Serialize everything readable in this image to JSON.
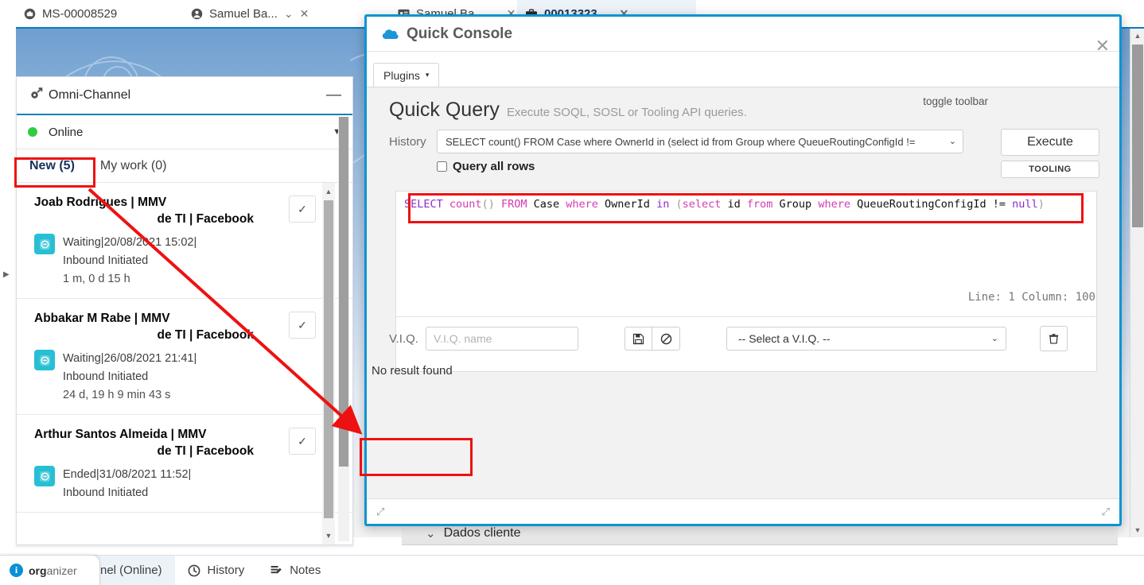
{
  "console_tabs": [
    {
      "label": "MS-00008529",
      "icon": "case-icon",
      "active": false
    },
    {
      "label": "Samuel Ba...",
      "icon": "person-icon",
      "active": false
    },
    {
      "label": "Samuel Ba...",
      "icon": "contact-card-icon",
      "active": false
    },
    {
      "label": "00013323",
      "icon": "briefcase-icon",
      "active": true
    }
  ],
  "omni": {
    "title": "Omni-Channel",
    "icon": "omni-channel-icon",
    "minimize_label": "—",
    "status": "Online",
    "tabs": [
      {
        "label": "New (5)",
        "selected": true
      },
      {
        "label": "My work (0)",
        "selected": false
      }
    ],
    "work_items": [
      {
        "name_first": "Joab Rodrigues | MMV",
        "name_second": "de TI | Facebook",
        "status_line": "Waiting|20/08/2021 15:02|",
        "type_line": "Inbound Initiated",
        "age": "1 m, 0 d 15 h",
        "accept_label": "✓"
      },
      {
        "name_first": "Abbakar M Rabe | MMV",
        "name_second": "de TI | Facebook",
        "status_line": "Waiting|26/08/2021 21:41|",
        "type_line": "Inbound Initiated",
        "age": "24 d, 19 h 9 min 43 s",
        "accept_label": "✓"
      },
      {
        "name_first": "Arthur Santos Almeida | MMV",
        "name_second": "de TI | Facebook",
        "status_line": "Ended|31/08/2021 11:52|",
        "type_line": "Inbound Initiated",
        "age": "",
        "accept_label": "✓"
      }
    ]
  },
  "background": {
    "dados_cliente": "Dados cliente",
    "dados_chevron": "⌄"
  },
  "quick_console": {
    "title": "Quick Console",
    "cloud_icon": "salesforce-cloud-icon",
    "close_label": "✕",
    "plugins_label": "Plugins",
    "plugins_caret": "▾",
    "toggle_toolbar": "toggle toolbar",
    "quick_query": {
      "heading": "Quick Query",
      "subheading": "Execute SOQL, SOSL or Tooling API queries.",
      "history_label": "History",
      "history_selected": "SELECT count() FROM Case where OwnerId in (select id from Group where QueueRoutingConfigId !=",
      "query_all_rows_label": "Query all rows",
      "query_all_rows_checked": false,
      "execute_label": "Execute",
      "tooling_label": "TOOLING"
    },
    "editor": {
      "tokens": [
        {
          "t": "SELECT",
          "c": "a"
        },
        {
          "t": " ",
          "c": "n"
        },
        {
          "t": "count",
          "c": "b"
        },
        {
          "t": "()",
          "c": "p"
        },
        {
          "t": " ",
          "c": "n"
        },
        {
          "t": "FROM",
          "c": "b"
        },
        {
          "t": " Case ",
          "c": "n"
        },
        {
          "t": "where",
          "c": "b"
        },
        {
          "t": " OwnerId ",
          "c": "n"
        },
        {
          "t": "in",
          "c": "a"
        },
        {
          "t": " ",
          "c": "n"
        },
        {
          "t": "(",
          "c": "p"
        },
        {
          "t": "select",
          "c": "b"
        },
        {
          "t": " id ",
          "c": "n"
        },
        {
          "t": "from",
          "c": "b"
        },
        {
          "t": " Group ",
          "c": "n"
        },
        {
          "t": "where",
          "c": "b"
        },
        {
          "t": " QueueRoutingConfigId != ",
          "c": "n"
        },
        {
          "t": "null",
          "c": "a"
        },
        {
          "t": ")",
          "c": "p"
        }
      ],
      "plain": "SELECT count() FROM Case where OwnerId in (select id from Group where QueueRoutingConfigId != null)",
      "line_column": "Line: 1 Column: 100"
    },
    "viq": {
      "label": "V.I.Q.",
      "name_placeholder": "V.I.Q. name",
      "name_value": "",
      "save_icon": "floppy-save-icon",
      "cancel_icon": "no-entry-icon",
      "select_value": "-- Select a V.I.Q. --",
      "select_arrow": "⌄",
      "delete_icon": "trash-icon"
    },
    "result_message": "No result found",
    "resize_handle_left": "⤢",
    "resize_handle_right": "⤢"
  },
  "utility_bar": {
    "items": [
      {
        "label": "nel (Online)",
        "icon": "omni-channel-icon",
        "active": true
      },
      {
        "label": "History",
        "icon": "clock-icon",
        "active": false
      },
      {
        "label": "Notes",
        "icon": "notes-icon",
        "active": false
      }
    ]
  },
  "organizer_badge": {
    "bold_text": "org",
    "rest_text": "anizer",
    "icon": "info-bulb-icon"
  },
  "colors": {
    "accent_blue": "#0b94d4",
    "omni_underline": "#1b7fb8",
    "annotation_red": "#ee1111",
    "online_green": "#2ecc40",
    "chip_teal": "#27bfd3",
    "kw_purple": "#8b2fc9",
    "kw_magenta": "#d33cb0"
  }
}
